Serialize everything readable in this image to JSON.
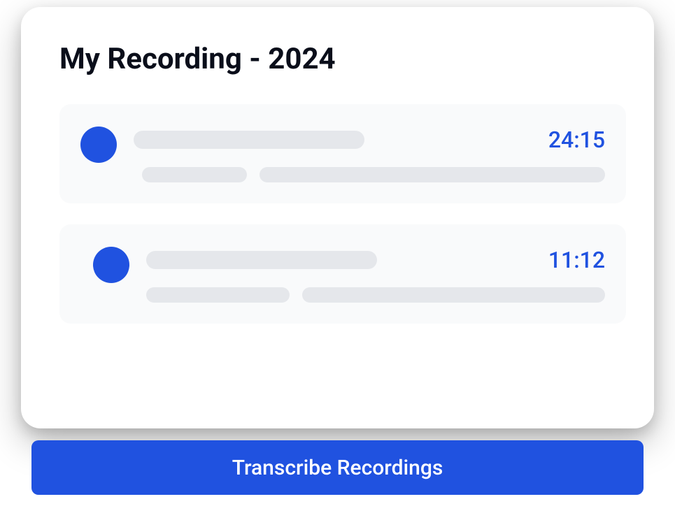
{
  "card": {
    "title": "My Recording - 2024"
  },
  "recordings": [
    {
      "duration": "24:15"
    },
    {
      "duration": "11:12"
    }
  ],
  "actions": {
    "transcribe_label": "Transcribe Recordings"
  },
  "colors": {
    "accent": "#2052e0",
    "card_bg": "#ffffff",
    "item_bg": "#f9fafb",
    "skeleton": "#e5e7eb",
    "text_dark": "#0a0e1a"
  }
}
